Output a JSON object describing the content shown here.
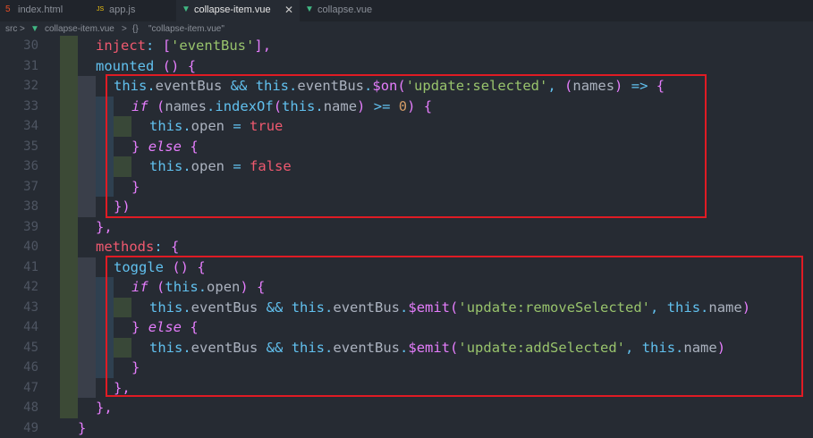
{
  "tabs": [
    {
      "icon": "html5-icon",
      "label": "index.html"
    },
    {
      "icon": "js-icon",
      "label": "app.js"
    },
    {
      "icon": "vue-icon",
      "label": "collapse-item.vue",
      "active": true
    },
    {
      "icon": "vue-icon",
      "label": "collapse.vue"
    }
  ],
  "breadcrumb": [
    "src",
    ">",
    "collapse-item.vue",
    ">",
    "{}",
    "\"collapse-item.vue\""
  ],
  "lines": [
    {
      "n": "30",
      "code": "inject: ['eventBus'],"
    },
    {
      "n": "31",
      "code": "mounted () {"
    },
    {
      "n": "32",
      "code": "this.eventBus && this.eventBus.$on('update:selected', (names) => {"
    },
    {
      "n": "33",
      "code": "if (names.indexOf(this.name) >= 0) {"
    },
    {
      "n": "34",
      "code": "this.open = true"
    },
    {
      "n": "35",
      "code": "} else {"
    },
    {
      "n": "36",
      "code": "this.open = false"
    },
    {
      "n": "37",
      "code": "}"
    },
    {
      "n": "38",
      "code": "})"
    },
    {
      "n": "39",
      "code": "},"
    },
    {
      "n": "40",
      "code": "methods: {"
    },
    {
      "n": "41",
      "code": "toggle () {"
    },
    {
      "n": "42",
      "code": "if (this.open) {"
    },
    {
      "n": "43",
      "code": "this.eventBus && this.eventBus.$emit('update:removeSelected', this.name)"
    },
    {
      "n": "44",
      "code": "} else {"
    },
    {
      "n": "45",
      "code": "this.eventBus && this.eventBus.$emit('update:addSelected', this.name)"
    },
    {
      "n": "46",
      "code": "}"
    },
    {
      "n": "47",
      "code": "},"
    },
    {
      "n": "48",
      "code": "},"
    },
    {
      "n": "49",
      "code": "}"
    }
  ],
  "colors": {
    "background": "#262b33",
    "keyword": "#e57dfc",
    "function": "#61c0ee",
    "string": "#98c36c",
    "highlight_box": "#e01b24"
  }
}
